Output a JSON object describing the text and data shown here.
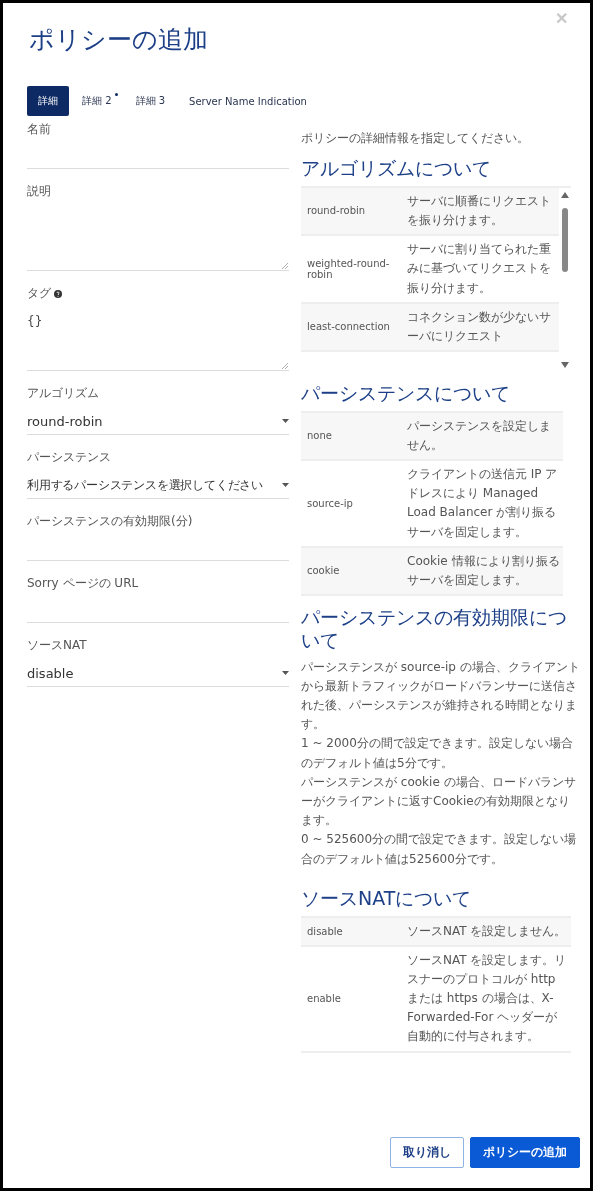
{
  "dialog": {
    "title": "ポリシーの追加",
    "close": "✕"
  },
  "tabs": [
    {
      "label": "詳細",
      "selected": true,
      "dot": false
    },
    {
      "label": "詳細 2",
      "selected": false,
      "dot": true
    },
    {
      "label": "詳細 3",
      "selected": false,
      "dot": false
    },
    {
      "label": "Server Name Indication",
      "selected": false,
      "dot": false
    }
  ],
  "fields": [
    {
      "kind": "input",
      "label": "名前",
      "help": false
    },
    {
      "kind": "textarea",
      "label": "説明",
      "help": false
    },
    {
      "kind": "textarea",
      "label": "タグ",
      "help": true,
      "value": "{}"
    },
    {
      "kind": "select",
      "label": "アルゴリズム",
      "help": false,
      "value": "round-robin"
    },
    {
      "kind": "select",
      "label": "パーシステンス",
      "help": false,
      "placeholder": "利用するパーシステンスを選択してください"
    },
    {
      "kind": "input",
      "label": "パーシステンスの有効期限(分)",
      "help": false
    },
    {
      "kind": "input",
      "label": "Sorry ページの URL",
      "help": false
    },
    {
      "kind": "select",
      "label": "ソースNAT",
      "help": false,
      "value": "disable"
    }
  ],
  "help_panel": {
    "intro": "ポリシーの詳細情報を指定してください。",
    "sections": [
      {
        "kind": "scroll_table",
        "heading": "アルゴリズムについて",
        "rows": [
          {
            "name": "round-robin",
            "description": "サーバに順番にリクエストを振り分けます。"
          },
          {
            "name": "weighted-round-robin",
            "description": "サーバに割り当てられた重みに基づいてリクエストを振り分けます。"
          },
          {
            "name": "least-connection",
            "description": "コネクション数が少ないサーバにリクエスト"
          }
        ]
      },
      {
        "kind": "table",
        "heading": "パーシステンスについて",
        "rows": [
          {
            "name": "none",
            "description": "パーシステンスを設定しません。"
          },
          {
            "name": "source-ip",
            "description": "クライアントの送信元 IP アドレスにより Managed Load Balancer が割り振るサーバを固定します。"
          },
          {
            "name": "cookie",
            "description": "Cookie 情報により割り振るサーバを固定します。"
          }
        ]
      },
      {
        "kind": "text",
        "heading": "パーシステンスの有効期限について",
        "paragraphs": [
          "パーシステンスが source-ip の場合、クライアントから最新トラフィックがロードバランサーに送信された後、パーシステンスが維持される時間となります。",
          "1 ~ 2000分の間で設定できます。設定しない場合のデフォルト値は5分です。",
          "パーシステンスが cookie の場合、ロードバランサーがクライアントに返すCookieの有効期限となります。",
          "0 ~ 525600分の間で設定できます。設定しない場合のデフォルト値は525600分です。"
        ]
      },
      {
        "kind": "table",
        "heading": "ソースNATについて",
        "rows": [
          {
            "name": "disable",
            "description": "ソースNAT を設定しません。"
          },
          {
            "name": "enable",
            "description": "ソースNAT を設定します。リスナーのプロトコルが http または https の場合は、X-Forwarded-For ヘッダーが自動的に付与されます。"
          }
        ]
      }
    ]
  },
  "buttons": [
    {
      "kind": "secondary",
      "label": "取り消し"
    },
    {
      "kind": "primary",
      "label": "ポリシーの追加"
    }
  ]
}
